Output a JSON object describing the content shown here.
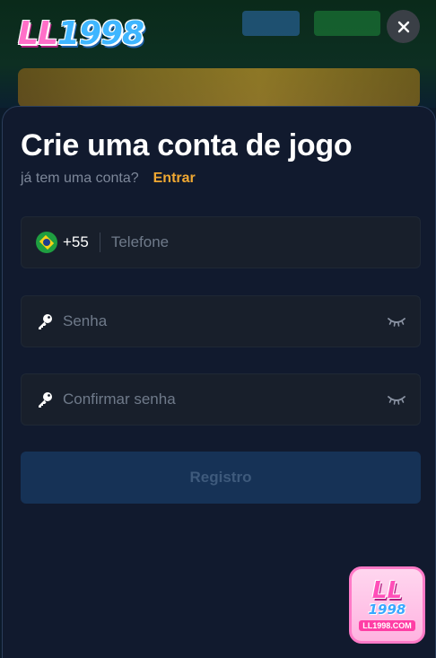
{
  "header": {
    "logo_text_letters": "LL",
    "logo_text_number": "1998",
    "close_label": "×"
  },
  "modal": {
    "title": "Crie uma conta de jogo",
    "subtitle_question": "já tem uma conta?",
    "login_link": "Entrar",
    "phone": {
      "country_code": "+55",
      "placeholder": "Telefone",
      "flag_icon": "brazil-flag-icon"
    },
    "password": {
      "placeholder": "Senha",
      "icon": "key-icon",
      "toggle_icon": "eye-closed-icon"
    },
    "confirm_password": {
      "placeholder": "Confirmar senha",
      "icon": "key-icon",
      "toggle_icon": "eye-closed-icon"
    },
    "submit_label": "Registro"
  },
  "floating_badge": {
    "logo_letters": "LL",
    "logo_number": "1998",
    "url": "LL1998.COM"
  },
  "colors": {
    "modal_background": "#111a2e",
    "field_background": "#181f2b",
    "link_accent": "#f0a832",
    "submit_background": "#163256",
    "logo_pink": "#ff6fc8",
    "logo_blue": "#3fb6ff"
  }
}
